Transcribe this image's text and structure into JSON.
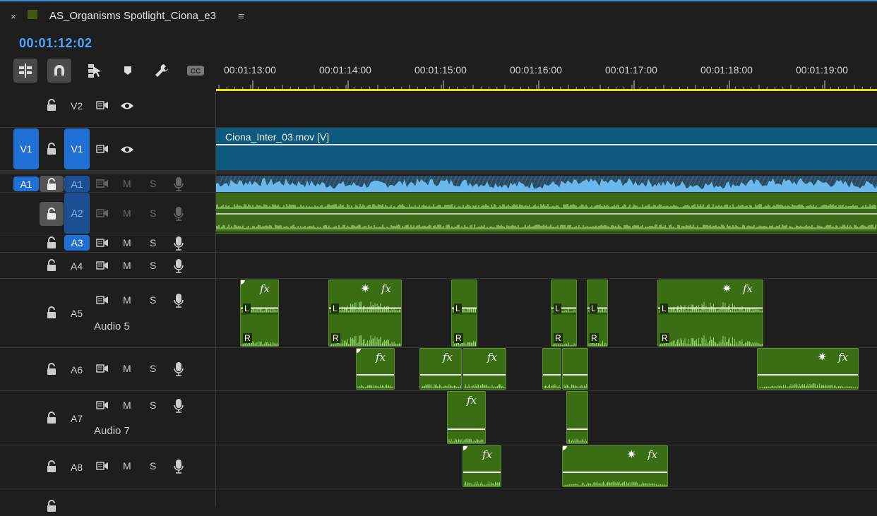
{
  "tab": {
    "close": "×",
    "title": "AS_Organisms Spotlight_Ciona_e3",
    "menu": "≡"
  },
  "timecode": "00:01:12:02",
  "toolbar": {
    "tools": [
      "insert-overwrite-icon",
      "snap-magnet-icon",
      "linked-selection-icon",
      "add-marker-icon",
      "wrench-icon",
      "captions-icon"
    ],
    "captions_label": "CC"
  },
  "ruler": {
    "labels": [
      "00:01:13:00",
      "00:01:14:00",
      "00:01:15:00",
      "00:01:16:00",
      "00:01:17:00",
      "00:01:18:00",
      "00:01:19:00"
    ]
  },
  "tracks": {
    "v2": {
      "name": "V2"
    },
    "v1": {
      "source": "V1",
      "name": "V1"
    },
    "a1": {
      "source": "A1",
      "name": "A1"
    },
    "a2": {
      "name": "A2"
    },
    "a3": {
      "name": "A3"
    },
    "a4": {
      "name": "A4"
    },
    "a5": {
      "name": "A5",
      "title": "Audio 5"
    },
    "a6": {
      "name": "A6"
    },
    "a7": {
      "name": "A7",
      "title": "Audio 7"
    },
    "a8": {
      "name": "A8"
    },
    "mute_label": "M",
    "solo_label": "S"
  },
  "clips": {
    "video": {
      "label": "Ciona_Inter_03.mov [V]"
    },
    "fx_label": "fx",
    "star_label": "✷",
    "left_label": "L",
    "right_label": "R"
  },
  "colors": {
    "accent": "#1f6fd4",
    "timecode": "#4da3ff",
    "video_clip": "#0e5a7e",
    "audio_clip": "#3a6d14",
    "waveform": "#8ed06a",
    "playbar": "#f0e000"
  }
}
